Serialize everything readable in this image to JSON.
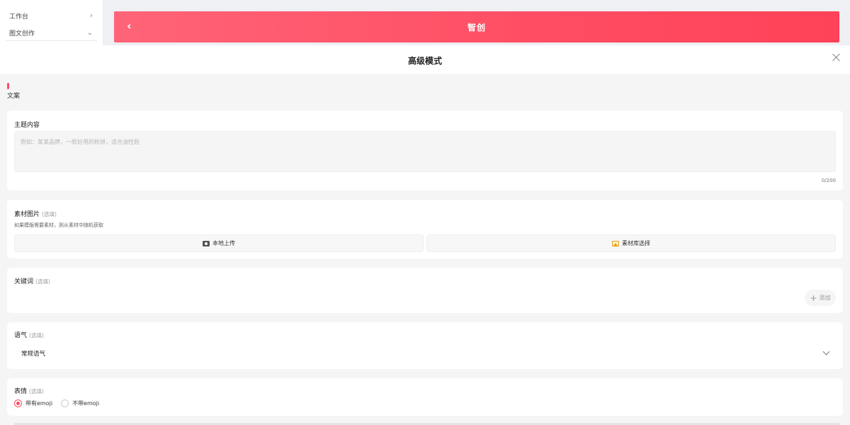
{
  "sidebar": {
    "items": [
      {
        "label": "工作台"
      },
      {
        "label": "图文创作"
      }
    ]
  },
  "header": {
    "title": "智创"
  },
  "modal": {
    "title": "高级模式",
    "section_label": "文案",
    "topic": {
      "label": "主题内容",
      "placeholder": "例如：某某品牌，一款好用的粉饼，适合油性脸",
      "counter": "0/200"
    },
    "material": {
      "label": "素材图片",
      "optional": "(选填)",
      "hint": "如果模版需要素材，则从素材中随机获取",
      "local_upload": "本地上传",
      "library_select": "素材库选择"
    },
    "keyword": {
      "label": "关键词",
      "optional": "(选填)",
      "add": "添加"
    },
    "tone": {
      "label": "语气",
      "optional": "(选填)",
      "value": "常规语气"
    },
    "emoji": {
      "label": "表情",
      "optional": "(选填)",
      "options": [
        "带有emoji",
        "不带emoji"
      ],
      "selected": "带有emoji"
    }
  },
  "colors": {
    "accent": "#ff4d63"
  }
}
